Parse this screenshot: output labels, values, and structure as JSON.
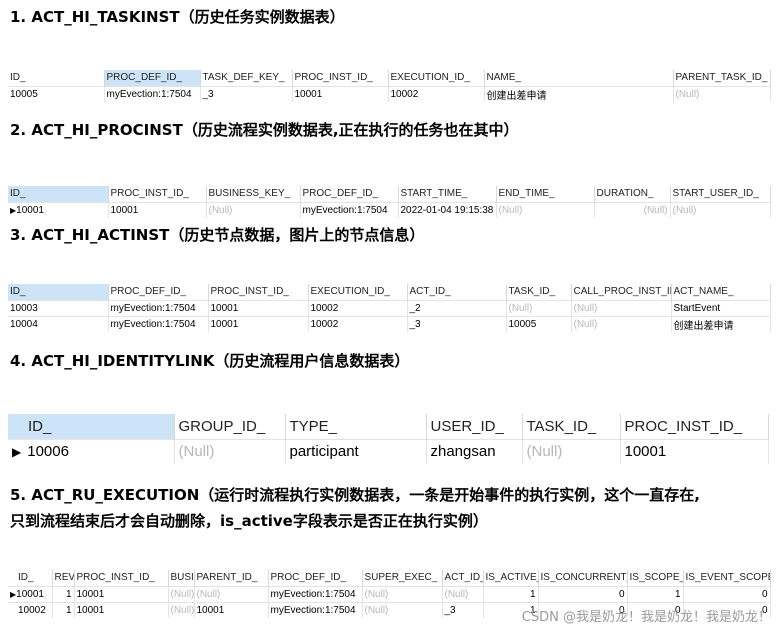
{
  "sections": [
    {
      "heading": "1. ACT_HI_TASKINST（历史任务实例数据表）",
      "columns": [
        "ID_",
        "PROC_DEF_ID_",
        "TASK_DEF_KEY_",
        "PROC_INST_ID_",
        "EXECUTION_ID_",
        "NAME_",
        "PARENT_TASK_ID_"
      ],
      "rows": [
        [
          "10005",
          "myEvection:1:7504",
          "_3",
          "10001",
          "10002",
          "创建出差申请",
          "(Null)"
        ]
      ]
    },
    {
      "heading": "2. ACT_HI_PROCINST（历史流程实例数据表,正在执行的任务也在其中）",
      "columns": [
        "ID_",
        "PROC_INST_ID_",
        "BUSINESS_KEY_",
        "PROC_DEF_ID_",
        "START_TIME_",
        "END_TIME_",
        "DURATION_",
        "START_USER_ID_"
      ],
      "rows": [
        [
          "10001",
          "10001",
          "(Null)",
          "myEvection:1:7504",
          "2022-01-04 19:15:38",
          "(Null)",
          "(Null)",
          "(Null)"
        ]
      ]
    },
    {
      "heading": "3. ACT_HI_ACTINST（历史节点数据，图片上的节点信息）",
      "columns": [
        "ID_",
        "PROC_DEF_ID_",
        "PROC_INST_ID_",
        "EXECUTION_ID_",
        "ACT_ID_",
        "TASK_ID_",
        "CALL_PROC_INST_ID_",
        "ACT_NAME_"
      ],
      "rows": [
        [
          "10003",
          "myEvection:1:7504",
          "10001",
          "10002",
          "_2",
          "(Null)",
          "(Null)",
          "StartEvent"
        ],
        [
          "10004",
          "myEvection:1:7504",
          "10001",
          "10002",
          "_3",
          "10005",
          "(Null)",
          "创建出差申请"
        ]
      ]
    },
    {
      "heading": "4. ACT_HI_IDENTITYLINK（历史流程用户信息数据表）",
      "columns": [
        "ID_",
        "GROUP_ID_",
        "TYPE_",
        "USER_ID_",
        "TASK_ID_",
        "PROC_INST_ID_"
      ],
      "rows": [
        [
          "10006",
          "(Null)",
          "participant",
          "zhangsan",
          "(Null)",
          "10001"
        ]
      ]
    },
    {
      "heading_line1": "5. ACT_RU_EXECUTION（运行时流程执行实例数据表，一条是开始事件的执行实例，这个一直存在,",
      "heading_line2": "只到流程结束后才会自动删除，is_active字段表示是否正在执行实例）",
      "columns": [
        "ID_",
        "REV",
        "PROC_INST_ID_",
        "BUSI",
        "PARENT_ID_",
        "PROC_DEF_ID_",
        "SUPER_EXEC_",
        "ACT_ID_",
        "IS_ACTIVE_",
        "IS_CONCURRENT_",
        "IS_SCOPE_",
        "IS_EVENT_SCOPE_"
      ],
      "rows": [
        [
          "10001",
          "1",
          "10001",
          "(Null)",
          "(Null)",
          "myEvection:1:7504",
          "(Null)",
          "(Null)",
          "1",
          "0",
          "1",
          "0"
        ],
        [
          "10002",
          "1",
          "10001",
          "(Null)",
          "10001",
          "myEvection:1:7504",
          "(Null)",
          "_3",
          "1",
          "0",
          "0",
          "0"
        ]
      ]
    }
  ],
  "current_row_marker": "▶",
  "watermark": "CSDN @我是奶龙！我是奶龙！我是奶龙！"
}
